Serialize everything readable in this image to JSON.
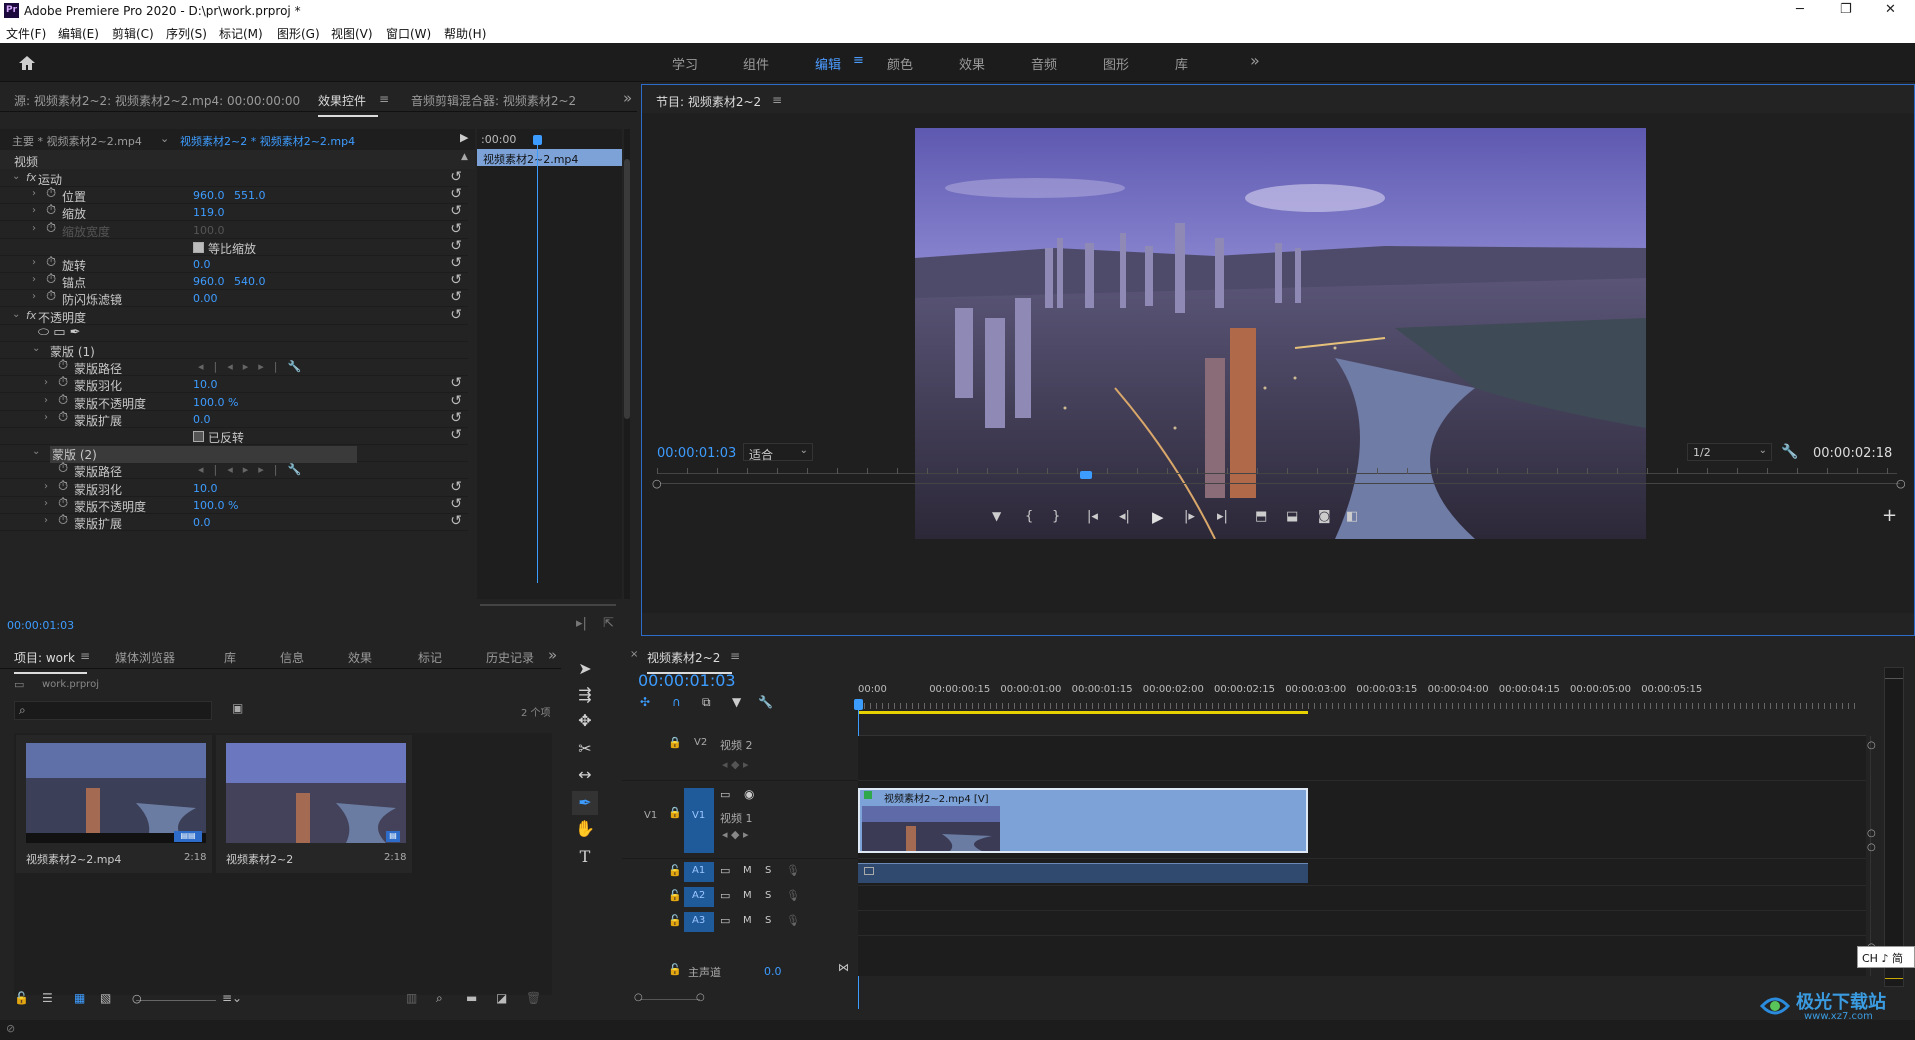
{
  "app": {
    "title": "Adobe Premiere Pro 2020 - D:\\pr\\work.prproj *",
    "icon_text": "Pr"
  },
  "window_controls": {
    "minimize": "─",
    "restore": "❐",
    "close": "✕"
  },
  "menu": [
    "文件(F)",
    "编辑(E)",
    "剪辑(C)",
    "序列(S)",
    "标记(M)",
    "图形(G)",
    "视图(V)",
    "窗口(W)",
    "帮助(H)"
  ],
  "workspaces": {
    "items": [
      "学习",
      "组件",
      "编辑",
      "颜色",
      "效果",
      "音频",
      "图形",
      "库"
    ],
    "active": "编辑",
    "more": "»"
  },
  "source_panel": {
    "tabs": [
      "源: 视频素材2~2: 视频素材2~2.mp4: 00:00:00:00",
      "效果控件",
      "音频剪辑混合器: 视频素材2~2"
    ],
    "active_tab": "效果控件",
    "more": "»",
    "master_label": "主要 * 视频素材2~2.mp4",
    "seq_label": "视频素材2~2 * 视频素材2~2.mp4",
    "mini_timecode": ":00:00",
    "mini_clip": "视频素材2~2.mp4",
    "section": "视频",
    "rows": [
      {
        "label": "运动",
        "fx": true
      },
      {
        "label": "位置",
        "v1": "960.0",
        "v2": "551.0"
      },
      {
        "label": "缩放",
        "v1": "119.0"
      },
      {
        "label": "缩放宽度",
        "v1": "100.0",
        "disabled": true
      },
      {
        "label": "等比缩放",
        "checkbox": true
      },
      {
        "label": "旋转",
        "v1": "0.0"
      },
      {
        "label": "锚点",
        "v1": "960.0",
        "v2": "540.0"
      },
      {
        "label": "防闪烁滤镜",
        "v1": "0.00"
      },
      {
        "label": "不透明度",
        "fx": true
      },
      {
        "label": "",
        "shapes": true
      },
      {
        "label": "蒙版 (1)"
      },
      {
        "label": "蒙版路径",
        "path": true
      },
      {
        "label": "蒙版羽化",
        "v1": "10.0"
      },
      {
        "label": "蒙版不透明度",
        "v1": "100.0 %"
      },
      {
        "label": "蒙版扩展",
        "v1": "0.0"
      },
      {
        "label": "已反转",
        "checkbox2": true
      },
      {
        "label": "蒙版 (2)",
        "highlight": true
      },
      {
        "label": "蒙版路径",
        "path": true
      },
      {
        "label": "蒙版羽化",
        "v1": "10.0"
      },
      {
        "label": "蒙版不透明度",
        "v1": "100.0 %"
      },
      {
        "label": "蒙版扩展",
        "v1": "0.0"
      }
    ],
    "timecode": "00:00:01:03"
  },
  "program": {
    "title": "节目: 视频素材2~2",
    "timecode": "00:00:01:03",
    "fit": "适合",
    "resolution": "1/2",
    "duration": "00:00:02:18"
  },
  "project": {
    "tabs": [
      "项目: work",
      "媒体浏览器",
      "库",
      "信息",
      "效果",
      "标记",
      "历史记录"
    ],
    "active_tab": "项目: work",
    "more": "»",
    "file": "work.prproj",
    "count": "2 个项",
    "items": [
      {
        "name": "视频素材2~2.mp4",
        "duration": "2:18"
      },
      {
        "name": "视频素材2~2",
        "duration": "2:18"
      }
    ]
  },
  "timeline": {
    "seq_tab": "视频素材2~2",
    "timecode": "00:00:01:03",
    "ruler": [
      "00:00",
      "00:00:00:15",
      "00:00:01:00",
      "00:00:01:15",
      "00:00:02:00",
      "00:00:02:15",
      "00:00:03:00",
      "00:00:03:15",
      "00:00:04:00",
      "00:00:04:15",
      "00:00:05:00",
      "00:00:05:15"
    ],
    "tracks": {
      "v2": {
        "label": "V2",
        "name": "视频 2"
      },
      "v1": {
        "label": "V1",
        "src": "V1",
        "name": "视频 1"
      },
      "a1": {
        "label": "A1"
      },
      "a2": {
        "label": "A2"
      },
      "a3": {
        "label": "A3"
      },
      "master": {
        "label": "主声道",
        "value": "0.0"
      }
    },
    "clip_label": "视频素材2~2.mp4 [V]"
  },
  "ime": "CH ♪ 简",
  "watermark": "极光下载站",
  "watermark_url": "www.xz7.com",
  "colors": {
    "accent": "#3d9cff",
    "clip": "#7ca2d8",
    "active_tab": "#4b9bff"
  }
}
